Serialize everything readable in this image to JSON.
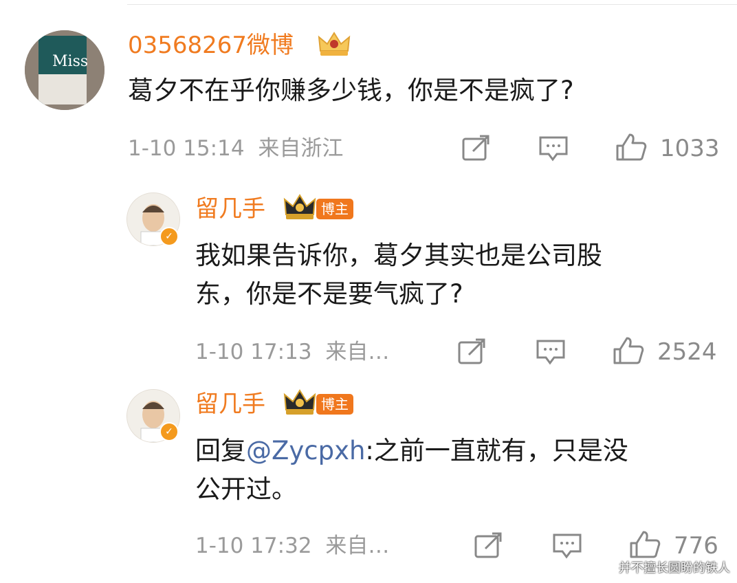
{
  "comments": [
    {
      "username": "03568267微博",
      "text": "葛夕不在乎你赚多少钱，你是不是疯了?",
      "time": "1-10 15:14",
      "location": "来自浙江",
      "likes": "1033"
    },
    {
      "username": "留几手",
      "badge": "博主",
      "text_line1": "我如果告诉你，葛夕其实也是公司股",
      "text_line2": "东，你是不是要气疯了?",
      "time": "1-10 17:13",
      "location": "来自…",
      "likes": "2524"
    },
    {
      "username": "留几手",
      "badge": "博主",
      "reply_prefix": "回复",
      "mention": "@Zycpxh",
      "text_rest": ":之前一直就有，只是没",
      "text_line2": "公开过。",
      "time": "1-10 17:32",
      "location": "来自…",
      "likes": "776"
    }
  ],
  "watermark": "并不擅长圆盼的铁人",
  "colors": {
    "username": "#f07b20",
    "mention": "#4a6aa5",
    "meta": "#9a9a9a",
    "badge": "#f0771d"
  },
  "icons": [
    "repost-icon",
    "comment-icon",
    "like-icon",
    "crown-icon",
    "verified-icon"
  ]
}
